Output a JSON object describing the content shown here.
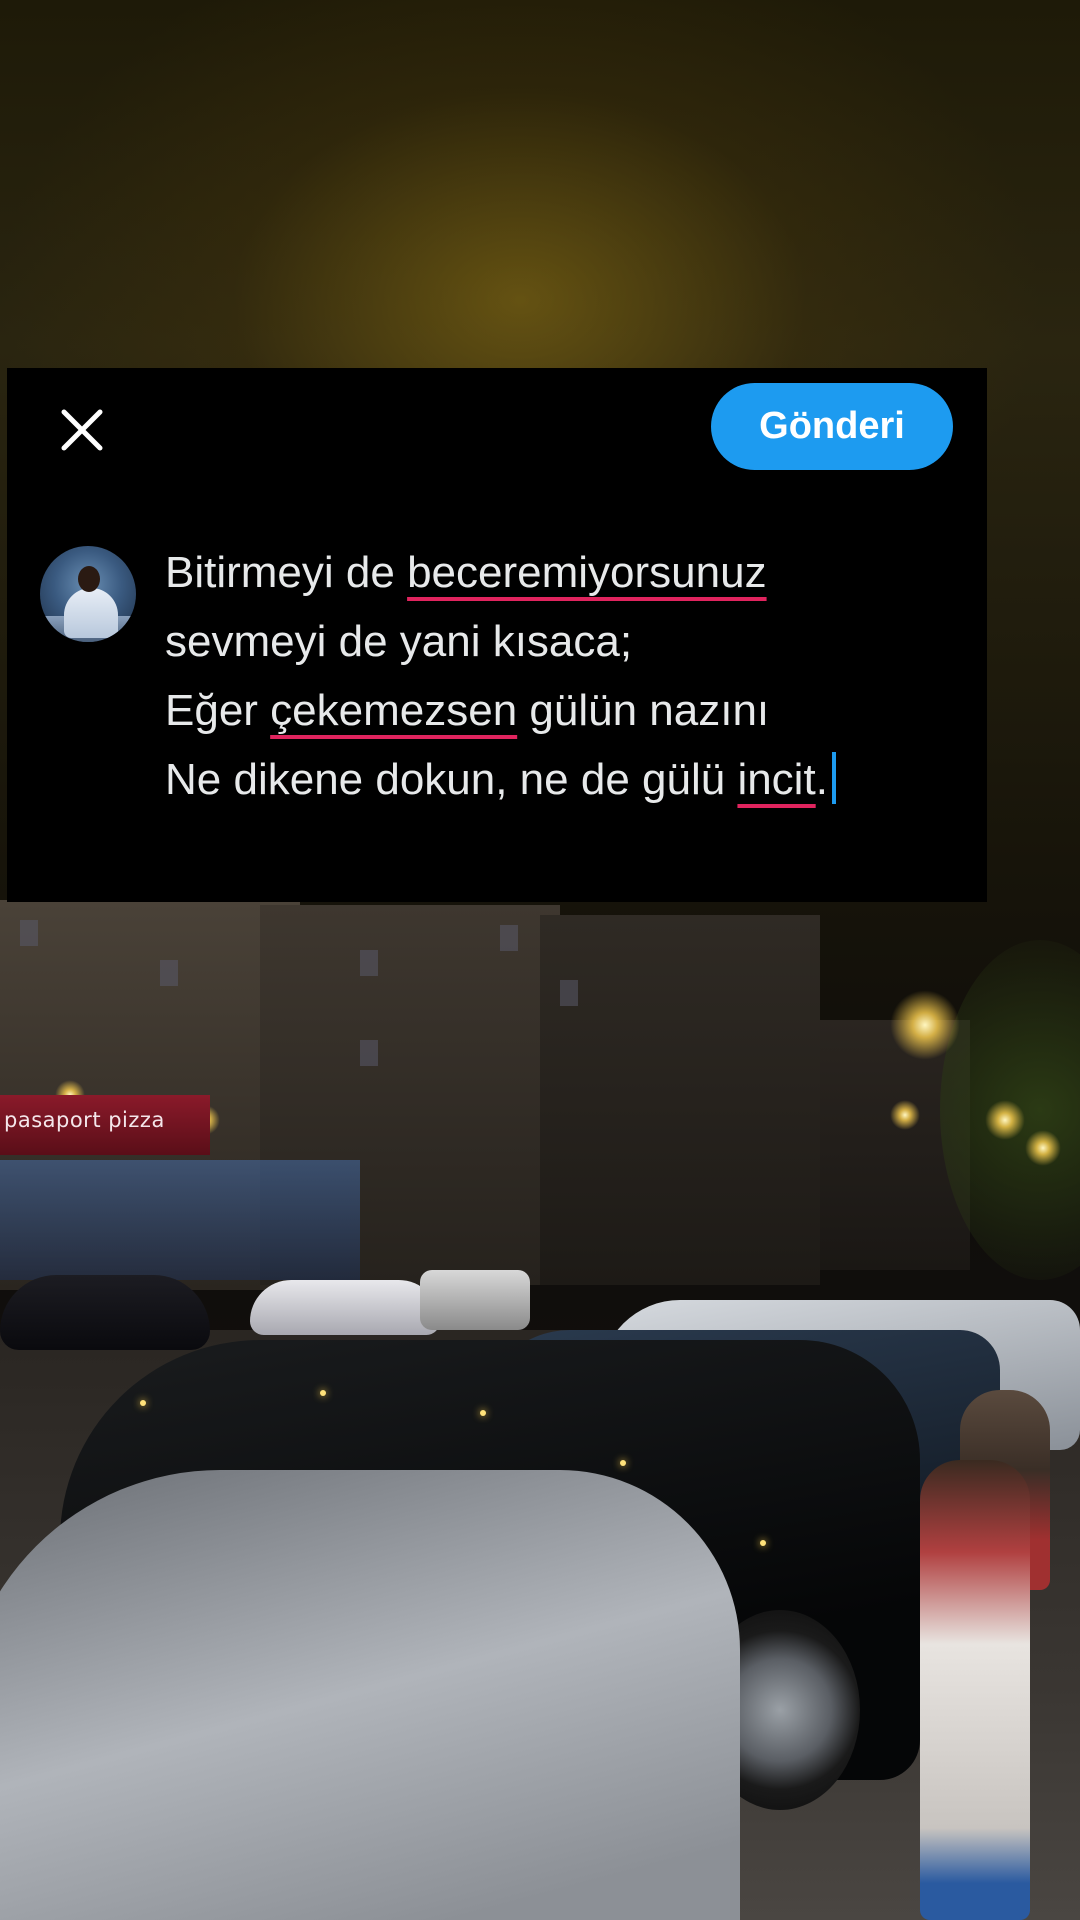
{
  "background": {
    "shop_sign": "pasaport pizza"
  },
  "header": {
    "close_icon": "close-icon",
    "post_button_label": "Gönderi"
  },
  "composer": {
    "avatar": "avatar",
    "lines": [
      [
        {
          "text": "Bitirmeyi de "
        },
        {
          "text": "beceremiyorsunuz",
          "misspelled": true
        }
      ],
      [
        {
          "text": "sevmeyi de yani kısaca;"
        }
      ],
      [
        {
          "text": "Eğer "
        },
        {
          "text": "çekemezsen",
          "misspelled": true
        },
        {
          "text": " gülün nazını"
        }
      ],
      [
        {
          "text": "Ne dikene dokun, ne de gülü "
        },
        {
          "text": "incit",
          "misspelled": true
        },
        {
          "text": "."
        }
      ]
    ]
  },
  "colors": {
    "accent": "#1d9bf0",
    "spellcheck_underline": "#e0245e",
    "panel_bg": "#000000",
    "text": "#e7e9ea"
  }
}
